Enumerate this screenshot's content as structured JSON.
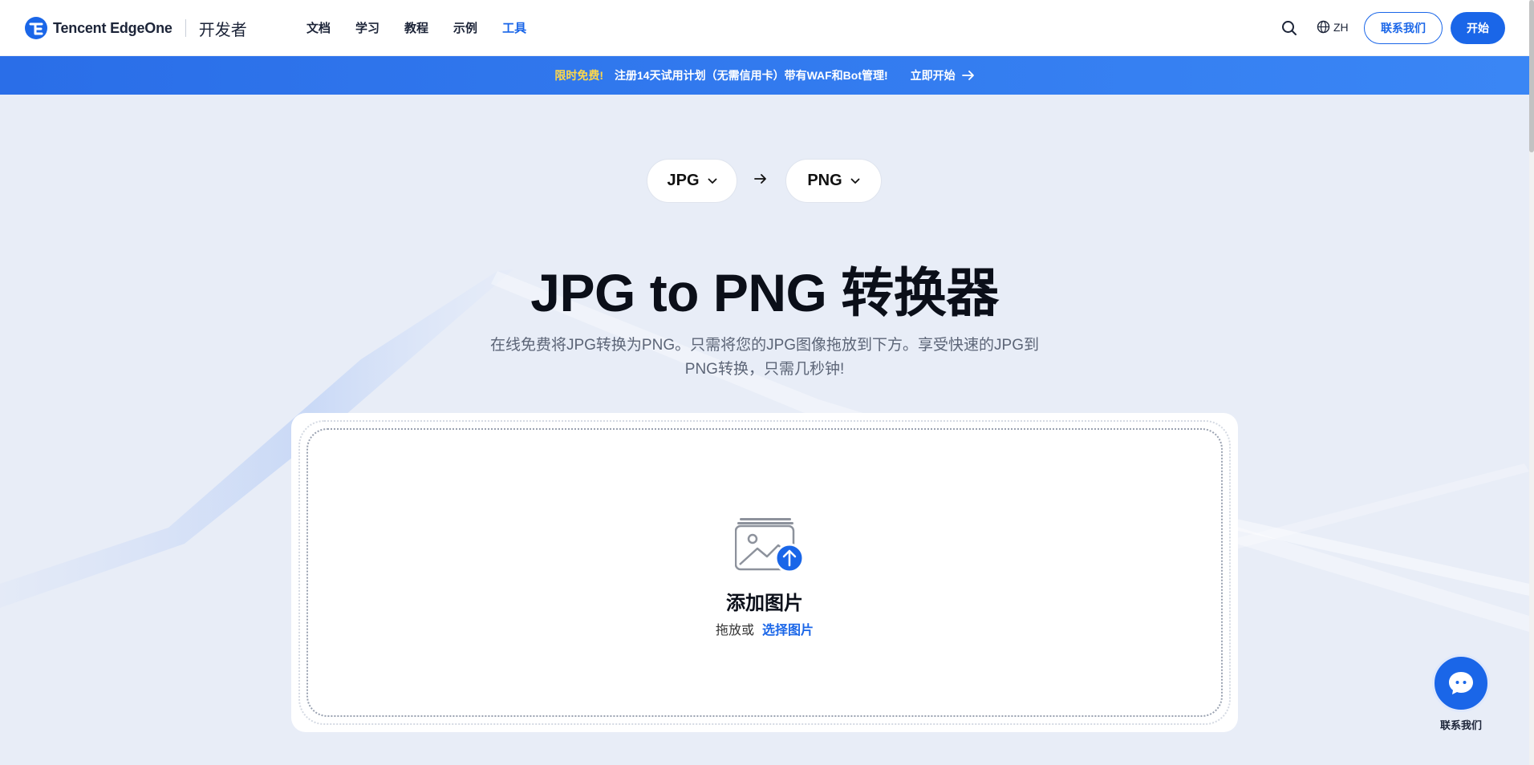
{
  "header": {
    "brand": "Tencent EdgeOne",
    "brand_sub": "开发者",
    "nav": [
      "文档",
      "学习",
      "教程",
      "示例",
      "工具"
    ],
    "active_nav": "工具",
    "lang": "ZH",
    "contact_label": "联系我们",
    "start_label": "开始"
  },
  "promo": {
    "badge": "限时免费!",
    "text": "注册14天试用计划（无需信用卡）带有WAF和Bot管理!",
    "link": "立即开始"
  },
  "converter": {
    "from_format": "JPG",
    "to_format": "PNG",
    "title": "JPG to PNG 转换器",
    "subtitle": "在线免费将JPG转换为PNG。只需将您的JPG图像拖放到下方。享受快速的JPG到PNG转换，只需几秒钟!"
  },
  "upload": {
    "title": "添加图片",
    "hint": "拖放或",
    "pick_label": "选择图片"
  },
  "chat": {
    "label": "联系我们"
  },
  "colors": {
    "accent": "#1a66e8",
    "promo_badge": "#ffd84a",
    "page_bg": "#e8edf7"
  },
  "icons": {
    "logo": "edgeone-logo-icon",
    "search": "search-icon",
    "globe": "globe-icon",
    "arrow_right": "arrow-right-icon",
    "chevron": "chevron-down-icon",
    "upload": "image-upload-icon",
    "chat": "chat-bubble-icon"
  }
}
